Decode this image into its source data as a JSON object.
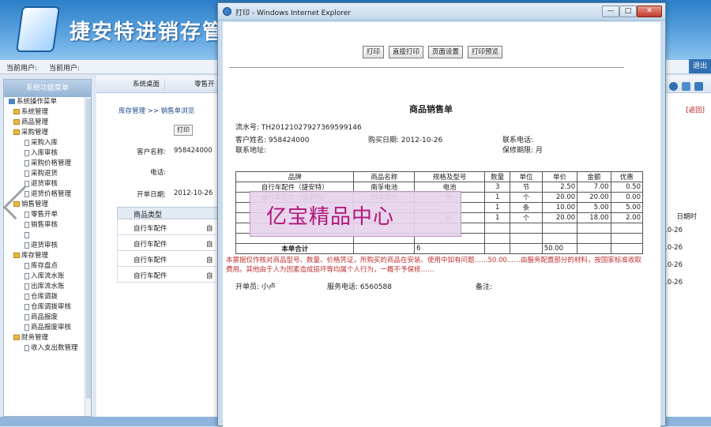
{
  "app": {
    "title": "捷安特进销存管",
    "current_user_label": "当前用户:",
    "current_user_label_2": "当前用户:",
    "logout": "退出"
  },
  "sidebar": {
    "header": "系统功能菜单",
    "items": [
      {
        "label": "系统操作菜单",
        "level": 0,
        "icon": "root"
      },
      {
        "label": "系统管理",
        "level": 1,
        "icon": "folder"
      },
      {
        "label": "商品管理",
        "level": 1,
        "icon": "folder"
      },
      {
        "label": "采购管理",
        "level": 1,
        "icon": "folder"
      },
      {
        "label": "采购入库",
        "level": 2,
        "icon": "page"
      },
      {
        "label": "入库审核",
        "level": 2,
        "icon": "page"
      },
      {
        "label": "采购价格管理",
        "level": 2,
        "icon": "page"
      },
      {
        "label": "采购退货",
        "level": 2,
        "icon": "page"
      },
      {
        "label": "退货审核",
        "level": 2,
        "icon": "page"
      },
      {
        "label": "退货价格管理",
        "level": 2,
        "icon": "page"
      },
      {
        "label": "销售管理",
        "level": 1,
        "icon": "folder"
      },
      {
        "label": "零售开单",
        "level": 2,
        "icon": "page"
      },
      {
        "label": "销售审核",
        "level": 2,
        "icon": "page"
      },
      {
        "label": "",
        "level": 2,
        "icon": "page"
      },
      {
        "label": "退货审核",
        "level": 2,
        "icon": "page"
      },
      {
        "label": "库存管理",
        "level": 1,
        "icon": "folder"
      },
      {
        "label": "库存盘点",
        "level": 2,
        "icon": "page"
      },
      {
        "label": "入库流水账",
        "level": 2,
        "icon": "page"
      },
      {
        "label": "出库流水账",
        "level": 2,
        "icon": "page"
      },
      {
        "label": "仓库调拨",
        "level": 2,
        "icon": "page"
      },
      {
        "label": "仓库调拨审核",
        "level": 2,
        "icon": "page"
      },
      {
        "label": "商品报废",
        "level": 2,
        "icon": "page"
      },
      {
        "label": "商品报废审核",
        "level": 2,
        "icon": "page"
      },
      {
        "label": "财务管理",
        "level": 1,
        "icon": "folder"
      },
      {
        "label": "收入支出数管理",
        "level": 2,
        "icon": "page"
      }
    ]
  },
  "main": {
    "tabs": [
      "系统桌面",
      "零售开"
    ],
    "breadcrumb": "库存管理 >> 销售单浏览",
    "print_small": "打印",
    "customer_label": "客户名称:",
    "customer_value": "958424000",
    "phone_label": "电话:",
    "date_label": "开单日期:",
    "date_value": "2012-10-26",
    "table_header": "商品类型",
    "rows": [
      "自行车配件",
      "自行车配件",
      "自行车配件",
      "自行车配件"
    ],
    "row_col2": [
      "自",
      "自",
      "自",
      "自"
    ],
    "back_link": "[返回]",
    "date_col_header": "日期时",
    "date_cells": [
      "-10-26",
      "-10-26",
      "-10-26",
      "-10-26"
    ]
  },
  "ie": {
    "title": "打印 - Windows Internet Explorer",
    "min": "—",
    "max": "□",
    "close": "✕",
    "toolbar": [
      "打印",
      "直接打印",
      "页面设置",
      "打印预览"
    ]
  },
  "receipt": {
    "title": "商品销售单",
    "serial": "流水号: TH20121027927369599146",
    "customer": "客户姓名: 958424000",
    "purchase_date": "购买日期: 2012-10-26",
    "contact_phone": "联系电话:",
    "contact_address": "联系地址:",
    "warranty": "保修期限: 月",
    "columns": [
      "品牌",
      "商品名称",
      "规格及型号",
      "数量",
      "单位",
      "单价",
      "金额",
      "优惠"
    ],
    "rows": [
      [
        "自行车配件（捷安特）",
        "南孚电池",
        "电池",
        "3",
        "节",
        "2.50",
        "7.00",
        "0.50"
      ],
      [
        "自行车配件（捷安特）",
        "20车首包",
        "包",
        "1",
        "个",
        "20.00",
        "20.00",
        "0.00"
      ],
      [
        "",
        "",
        "",
        "1",
        "条",
        "10.00",
        "5.00",
        "5.00"
      ],
      [
        "",
        "",
        "灯",
        "1",
        "个",
        "20.00",
        "18.00",
        "2.00"
      ],
      [
        "",
        "",
        "",
        "",
        "",
        "",
        "",
        ""
      ],
      [
        "",
        "",
        "",
        "",
        "",
        "",
        "",
        ""
      ]
    ],
    "total_label": "本单合计",
    "total_qty": "6",
    "total_amount": "50.00",
    "watermark": "亿宝精品中心",
    "notice": "本票据仅作核对商品型号、数量、价格凭证，所购买的商品在安装、使用中如有问题……50.00……由服务配置部分的材料，按国家标准收取费用。其他由于人为因素造成损坏等均属个人行为，一概不予保修……",
    "operator": "开单员: 小卢",
    "service_phone": "服务电话: 6560588",
    "remark": "备注:"
  }
}
